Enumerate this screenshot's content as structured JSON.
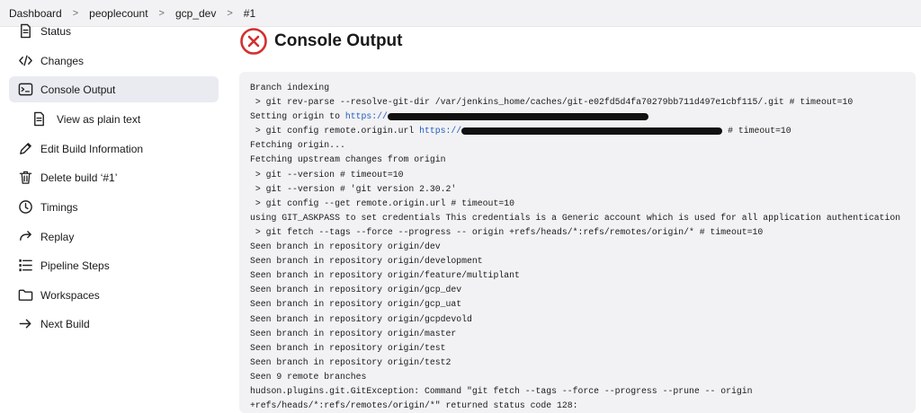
{
  "breadcrumb": [
    "Dashboard",
    "peoplecount",
    "gcp_dev",
    "#1"
  ],
  "sidebar": {
    "items": [
      {
        "label": "Status",
        "icon": "document-icon"
      },
      {
        "label": "Changes",
        "icon": "code-icon"
      },
      {
        "label": "Console Output",
        "icon": "terminal-icon",
        "active": true
      },
      {
        "label": "View as plain text",
        "icon": "document-icon"
      },
      {
        "label": "Edit Build Information",
        "icon": "edit-icon"
      },
      {
        "label": "Delete build ‘#1’",
        "icon": "trash-icon"
      },
      {
        "label": "Timings",
        "icon": "clock-icon"
      },
      {
        "label": "Replay",
        "icon": "replay-icon"
      },
      {
        "label": "Pipeline Steps",
        "icon": "list-icon"
      },
      {
        "label": "Workspaces",
        "icon": "folder-icon"
      },
      {
        "label": "Next Build",
        "icon": "arrow-right-icon"
      }
    ]
  },
  "page": {
    "title": "Console Output",
    "status_icon": "failed-x-icon",
    "status_color": "#d32f2f"
  },
  "console": {
    "lines": [
      "Branch indexing",
      " > git rev-parse --resolve-git-dir /var/jenkins_home/caches/git-e02fd5d4fa70279bb711d497e1cbf115/.git # timeout=10",
      "Setting origin to",
      " > git config remote.origin.url",
      "Fetching origin...",
      "Fetching upstream changes from origin",
      " > git --version # timeout=10",
      " > git --version # 'git version 2.30.2'",
      " > git config --get remote.origin.url # timeout=10",
      "using GIT_ASKPASS to set credentials This credentials is a Generic account which is used for all application authentication",
      " > git fetch --tags --force --progress -- origin +refs/heads/*:refs/remotes/origin/* # timeout=10",
      "Seen branch in repository origin/dev",
      "Seen branch in repository origin/development",
      "Seen branch in repository origin/feature/multiplant",
      "Seen branch in repository origin/gcp_dev",
      "Seen branch in repository origin/gcp_uat",
      "Seen branch in repository origin/gcpdevold",
      "Seen branch in repository origin/master",
      "Seen branch in repository origin/test",
      "Seen branch in repository origin/test2",
      "Seen 9 remote branches",
      "hudson.plugins.git.GitException: Command \"git fetch --tags --force --progress --prune -- origin",
      "+refs/heads/*:refs/remotes/origin/*\" returned status code 128:"
    ],
    "origin_link": "https://",
    "remote_url_link": "https://",
    "remote_url_suffix": " # timeout=10"
  }
}
